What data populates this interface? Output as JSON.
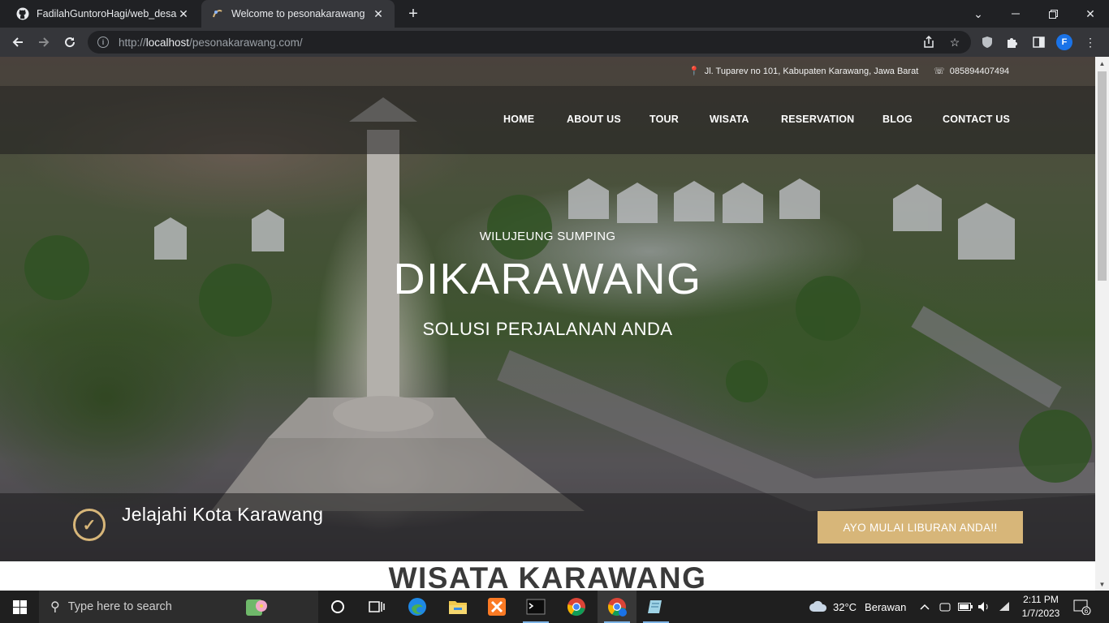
{
  "browser": {
    "tabs": [
      {
        "title": "FadilahGuntoroHagi/web_desasih",
        "active": false
      },
      {
        "title": "Welcome to pesonakarawang",
        "active": true
      }
    ],
    "url_prefix": "http://",
    "url_host": "localhost",
    "url_path": "/pesonakarawang.com/",
    "profile_initial": "F"
  },
  "topbar": {
    "address": "Jl. Tuparev no 101, Kabupaten Karawang, Jawa Barat",
    "phone": "085894407494"
  },
  "nav": [
    "HOME",
    "ABOUT US",
    "TOUR",
    "WISATA",
    "RESERVATION",
    "BLOG",
    "CONTACT US"
  ],
  "hero": {
    "welcome": "WILUJEUNG SUMPING",
    "headline": "DIKARAWANG",
    "tagline": "SOLUSI PERJALANAN ANDA"
  },
  "cta_band": {
    "text": "Jelajahi Kota Karawang",
    "button": "AYO MULAI LIBURAN ANDA!!"
  },
  "section": {
    "title": "WISATA KARAWANG"
  },
  "taskbar": {
    "search_placeholder": "Type here to search",
    "weather_temp": "32°C",
    "weather_desc": "Berawan",
    "time": "2:11 PM",
    "date": "1/7/2023",
    "notification_count": "6"
  },
  "colors": {
    "accent": "#d7b679",
    "chrome_dark": "#202124",
    "chrome_toolbar": "#35363a"
  }
}
